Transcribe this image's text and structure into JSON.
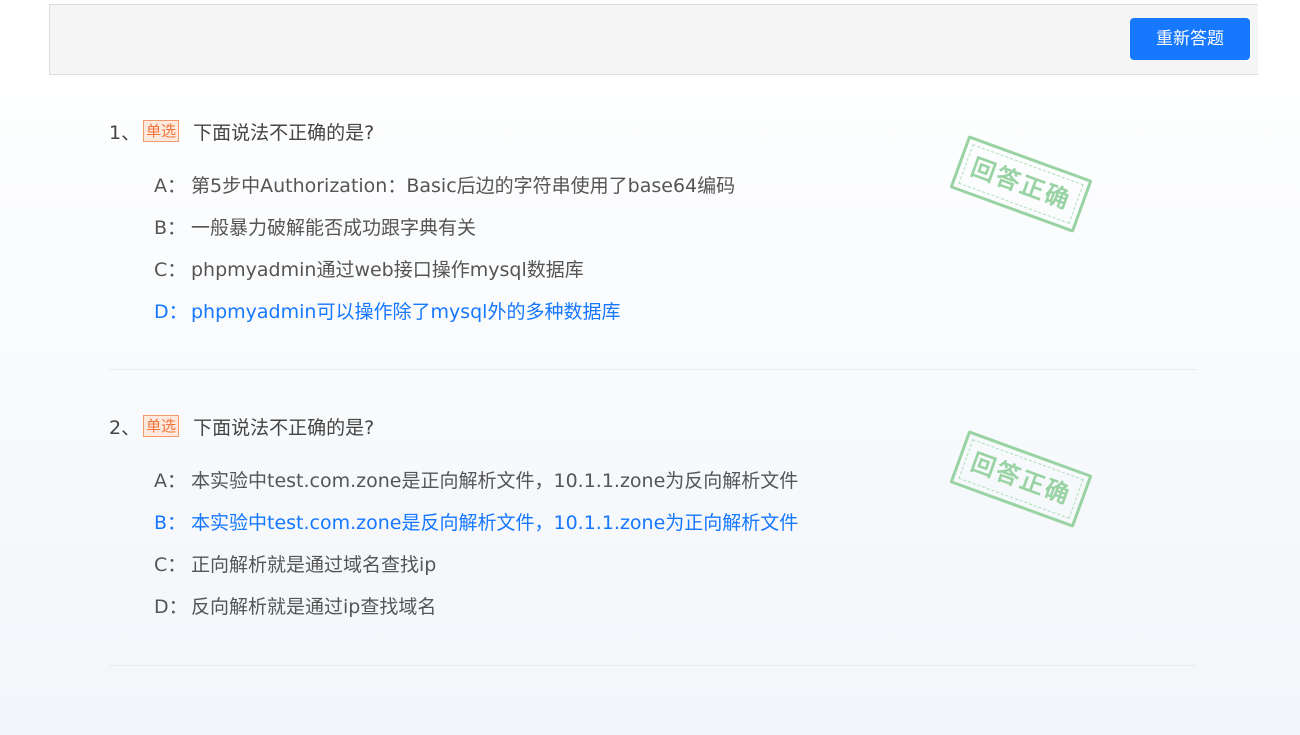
{
  "toolbar": {
    "retry_label": "重新答题",
    "accent_color": "#1677ff"
  },
  "questions": [
    {
      "number": "1、",
      "type_tag": "单选",
      "text": "下面说法不正确的是?",
      "stamp": "回答正确",
      "correct_option": "D",
      "options": [
        {
          "letter": "A：",
          "text": "第5步中Authorization：Basic后边的字符串使用了base64编码"
        },
        {
          "letter": "B：",
          "text": "一般暴力破解能否成功跟字典有关"
        },
        {
          "letter": "C：",
          "text": "phpmyadmin通过web接口操作mysql数据库"
        },
        {
          "letter": "D：",
          "text": "phpmyadmin可以操作除了mysql外的多种数据库"
        }
      ]
    },
    {
      "number": "2、",
      "type_tag": "单选",
      "text": "下面说法不正确的是?",
      "stamp": "回答正确",
      "correct_option": "B",
      "options": [
        {
          "letter": "A：",
          "text": "本实验中test.com.zone是正向解析文件，10.1.1.zone为反向解析文件"
        },
        {
          "letter": "B：",
          "text": "本实验中test.com.zone是反向解析文件，10.1.1.zone为正向解析文件"
        },
        {
          "letter": "C：",
          "text": "正向解析就是通过域名查找ip"
        },
        {
          "letter": "D：",
          "text": "反向解析就是通过ip查找域名"
        }
      ]
    }
  ]
}
